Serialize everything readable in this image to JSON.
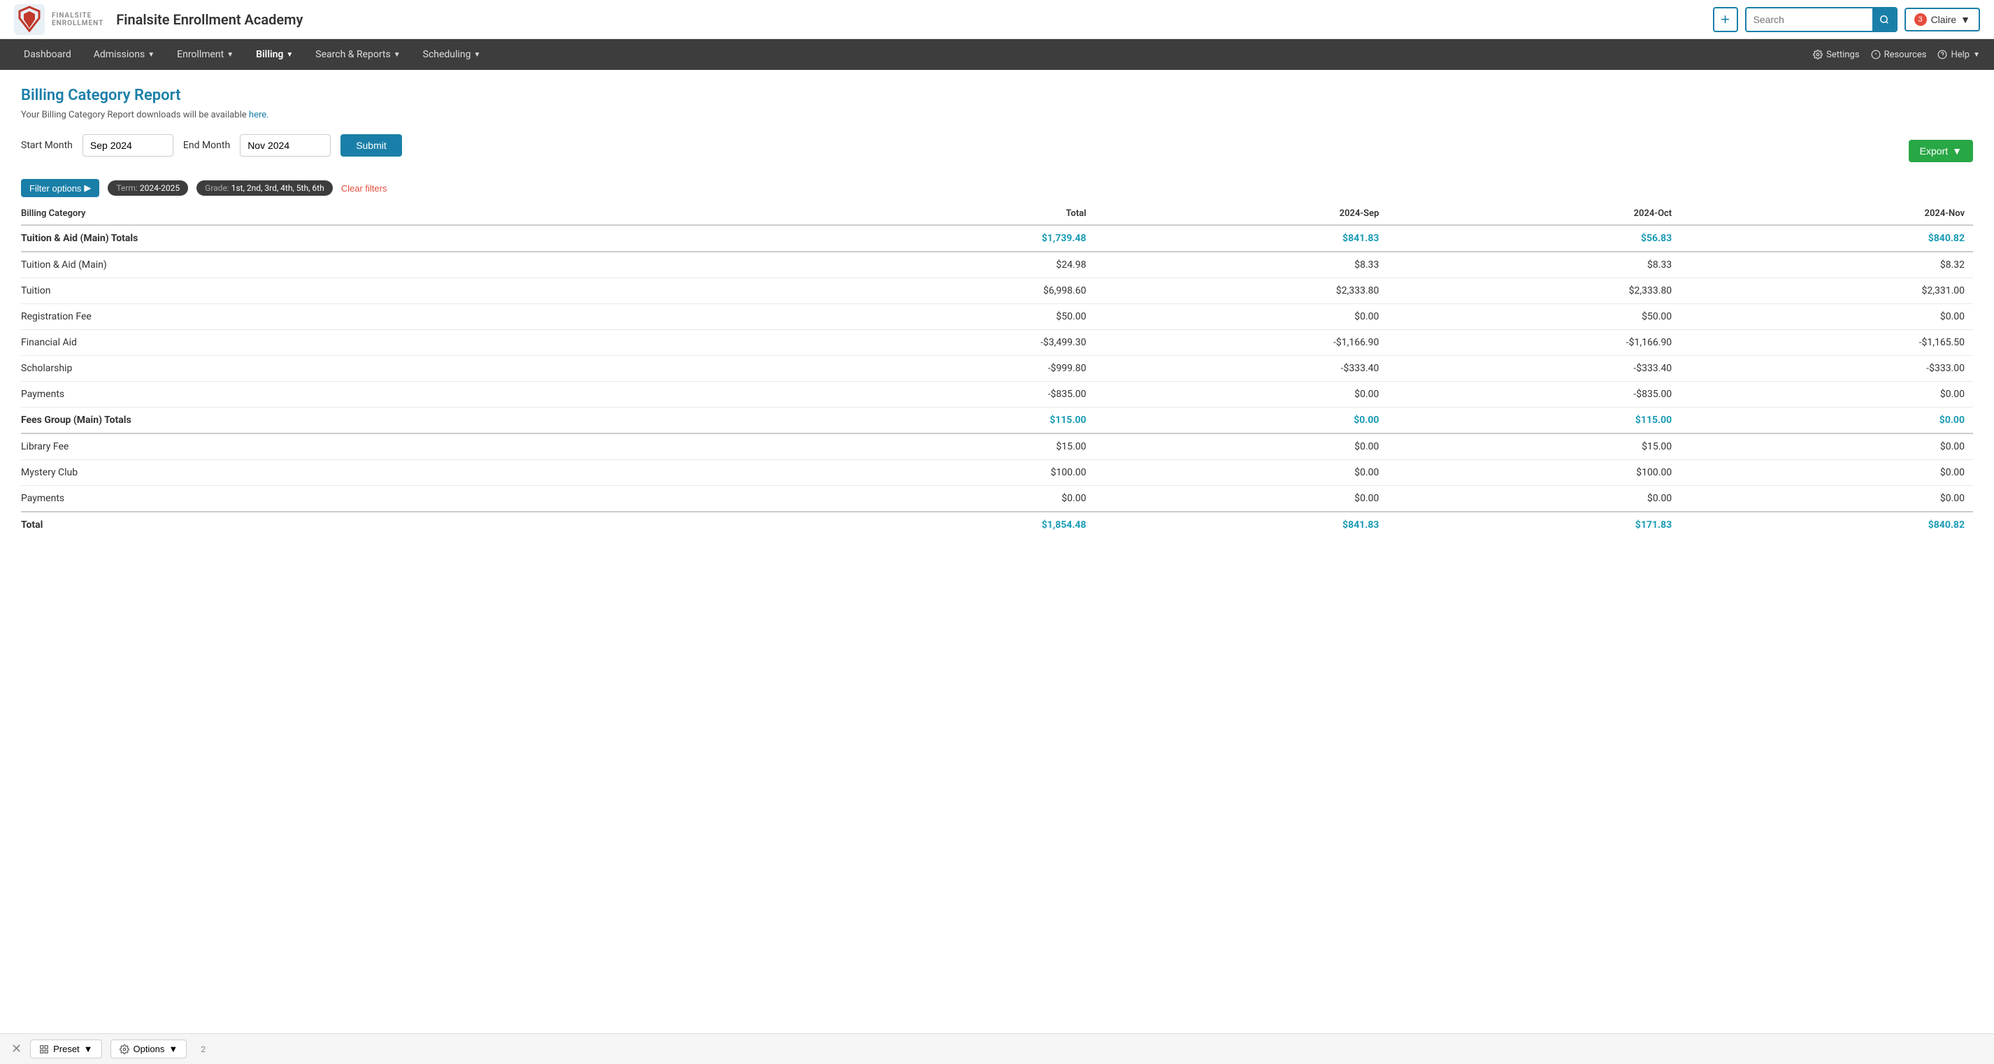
{
  "app": {
    "name": "Finalsite Enrollment Academy"
  },
  "header": {
    "search_placeholder": "Search",
    "notification_count": "3",
    "user_name": "Claire",
    "add_label": "+"
  },
  "nav": {
    "items": [
      {
        "id": "dashboard",
        "label": "Dashboard",
        "has_chevron": false
      },
      {
        "id": "admissions",
        "label": "Admissions",
        "has_chevron": true
      },
      {
        "id": "enrollment",
        "label": "Enrollment",
        "has_chevron": true
      },
      {
        "id": "billing",
        "label": "Billing",
        "has_chevron": true
      },
      {
        "id": "search-reports",
        "label": "Search & Reports",
        "has_chevron": true
      },
      {
        "id": "scheduling",
        "label": "Scheduling",
        "has_chevron": true
      }
    ],
    "right_items": [
      {
        "id": "settings",
        "label": "Settings",
        "icon": "gear"
      },
      {
        "id": "resources",
        "label": "Resources",
        "icon": "info"
      },
      {
        "id": "help",
        "label": "Help",
        "icon": "question",
        "has_chevron": true
      }
    ]
  },
  "page": {
    "title": "Billing Category Report",
    "subtitle": "Your Billing Category Report downloads will be available",
    "subtitle_link": "here.",
    "start_month_label": "Start Month",
    "start_month_value": "Sep 2024",
    "end_month_label": "End Month",
    "end_month_value": "Nov 2024",
    "submit_label": "Submit",
    "export_label": "Export"
  },
  "filters": {
    "filter_options_label": "Filter options",
    "term_label": "Term:",
    "term_value": "2024-2025",
    "grade_label": "Grade:",
    "grade_value": "1st, 2nd, 3rd, 4th, 5th, 6th",
    "clear_label": "Clear filters"
  },
  "table": {
    "columns": [
      "Billing Category",
      "Total",
      "2024-Sep",
      "2024-Oct",
      "2024-Nov"
    ],
    "rows": [
      {
        "id": "tuition-aid-totals",
        "type": "group-total",
        "category": "Tuition & Aid (Main) Totals",
        "total": "$1,739.48",
        "sep": "$841.83",
        "oct": "$56.83",
        "nov": "$840.82",
        "teal": true
      },
      {
        "id": "tuition-aid-main",
        "type": "row",
        "category": "Tuition & Aid (Main)",
        "total": "$24.98",
        "sep": "$8.33",
        "oct": "$8.33",
        "nov": "$8.32",
        "teal": false
      },
      {
        "id": "tuition",
        "type": "row",
        "category": "Tuition",
        "total": "$6,998.60",
        "sep": "$2,333.80",
        "oct": "$2,333.80",
        "nov": "$2,331.00",
        "teal": false
      },
      {
        "id": "registration-fee",
        "type": "row",
        "category": "Registration Fee",
        "total": "$50.00",
        "sep": "$0.00",
        "oct": "$50.00",
        "nov": "$0.00",
        "teal": false
      },
      {
        "id": "financial-aid",
        "type": "row",
        "category": "Financial Aid",
        "total": "-$3,499.30",
        "sep": "-$1,166.90",
        "oct": "-$1,166.90",
        "nov": "-$1,165.50",
        "teal": false
      },
      {
        "id": "scholarship",
        "type": "row",
        "category": "Scholarship",
        "total": "-$999.80",
        "sep": "-$333.40",
        "oct": "-$333.40",
        "nov": "-$333.00",
        "teal": false
      },
      {
        "id": "payments-1",
        "type": "row",
        "category": "Payments",
        "total": "-$835.00",
        "sep": "$0.00",
        "oct": "-$835.00",
        "nov": "$0.00",
        "teal": false
      },
      {
        "id": "fees-group-totals",
        "type": "group-total",
        "category": "Fees Group (Main) Totals",
        "total": "$115.00",
        "sep": "$0.00",
        "oct": "$115.00",
        "nov": "$0.00",
        "teal": true
      },
      {
        "id": "library-fee",
        "type": "row",
        "category": "Library Fee",
        "total": "$15.00",
        "sep": "$0.00",
        "oct": "$15.00",
        "nov": "$0.00",
        "teal": false
      },
      {
        "id": "mystery-club",
        "type": "row",
        "category": "Mystery Club",
        "total": "$100.00",
        "sep": "$0.00",
        "oct": "$100.00",
        "nov": "$0.00",
        "teal": false
      },
      {
        "id": "payments-2",
        "type": "row",
        "category": "Payments",
        "total": "$0.00",
        "sep": "$0.00",
        "oct": "$0.00",
        "nov": "$0.00",
        "teal": false
      },
      {
        "id": "grand-total",
        "type": "grand-total",
        "category": "Total",
        "total": "$1,854.48",
        "sep": "$841.83",
        "oct": "$171.83",
        "nov": "$840.82",
        "teal": true
      }
    ]
  },
  "bottom_bar": {
    "preset_label": "Preset",
    "options_label": "Options",
    "page_info": "2"
  }
}
